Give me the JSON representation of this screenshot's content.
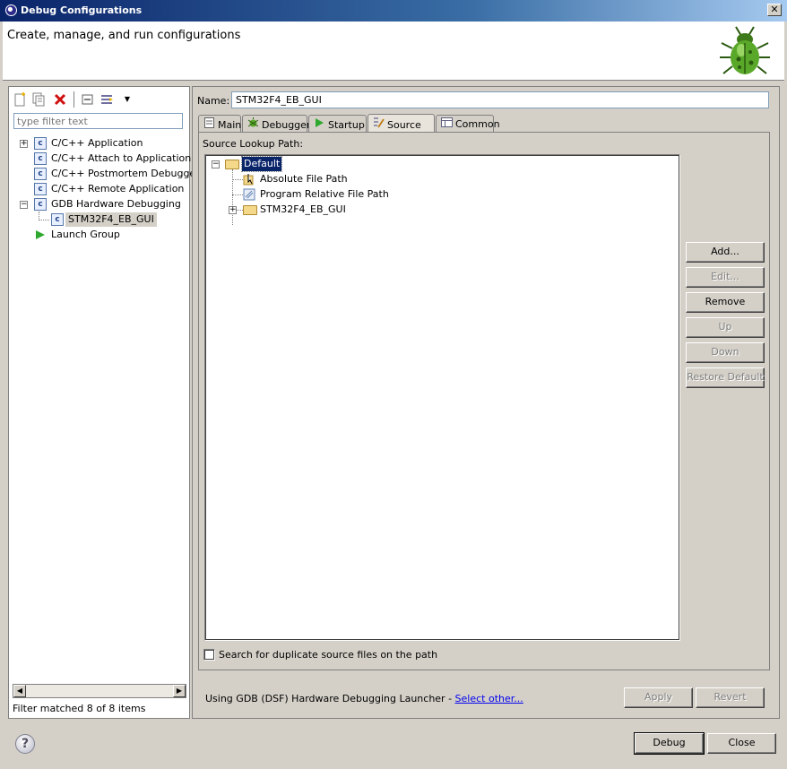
{
  "window": {
    "title": "Debug Configurations",
    "close_glyph": "✕"
  },
  "header": {
    "title": "Create, manage, and run configurations",
    "logo_icon": "bug-icon"
  },
  "left": {
    "toolbar": {
      "icons": [
        "new-configuration-icon",
        "duplicate-icon",
        "delete-icon",
        "collapse-all-icon",
        "filter-icon",
        "dropdown-arrow-icon"
      ]
    },
    "filter_placeholder": "type filter text",
    "tree": [
      {
        "label": "C/C++ Application",
        "expanded": false
      },
      {
        "label": "C/C++ Attach to Application"
      },
      {
        "label": "C/C++ Postmortem Debugger"
      },
      {
        "label": "C/C++ Remote Application"
      },
      {
        "label": "GDB Hardware Debugging",
        "expanded": true
      },
      {
        "label": "STM32F4_EB_GUI",
        "selected": true
      },
      {
        "label": "Launch Group"
      }
    ],
    "filter_status": "Filter matched 8 of 8 items"
  },
  "right": {
    "name_label": "Name:",
    "name_value": "STM32F4_EB_GUI",
    "tabs": [
      {
        "label": "Main",
        "icon": "main-tab-icon"
      },
      {
        "label": "Debugger",
        "icon": "debugger-icon"
      },
      {
        "label": "Startup",
        "icon": "startup-icon"
      },
      {
        "label": "Source",
        "icon": "source-icon",
        "active": true
      },
      {
        "label": "Common",
        "icon": "common-icon"
      }
    ],
    "source": {
      "lookup_label": "Source Lookup Path:",
      "tree": [
        {
          "label": "Default",
          "selected": true
        },
        {
          "label": "Absolute File Path"
        },
        {
          "label": "Program Relative File Path"
        },
        {
          "label": "STM32F4_EB_GUI"
        }
      ],
      "buttons": [
        {
          "label": "Add...",
          "enabled": true
        },
        {
          "label": "Edit...",
          "enabled": false
        },
        {
          "label": "Remove",
          "enabled": true
        },
        {
          "label": "Up",
          "enabled": false
        },
        {
          "label": "Down",
          "enabled": false
        },
        {
          "label": "Restore Default",
          "enabled": false
        }
      ],
      "duplicate_checkbox_label": "Search for duplicate source files on the path",
      "duplicate_checked": false
    },
    "launcher_text": "Using GDB (DSF) Hardware Debugging Launcher - ",
    "select_other_link": "Select other...",
    "apply_label": "Apply",
    "revert_label": "Revert"
  },
  "footer": {
    "help_glyph": "?",
    "debug_label": "Debug",
    "close_label": "Close"
  }
}
